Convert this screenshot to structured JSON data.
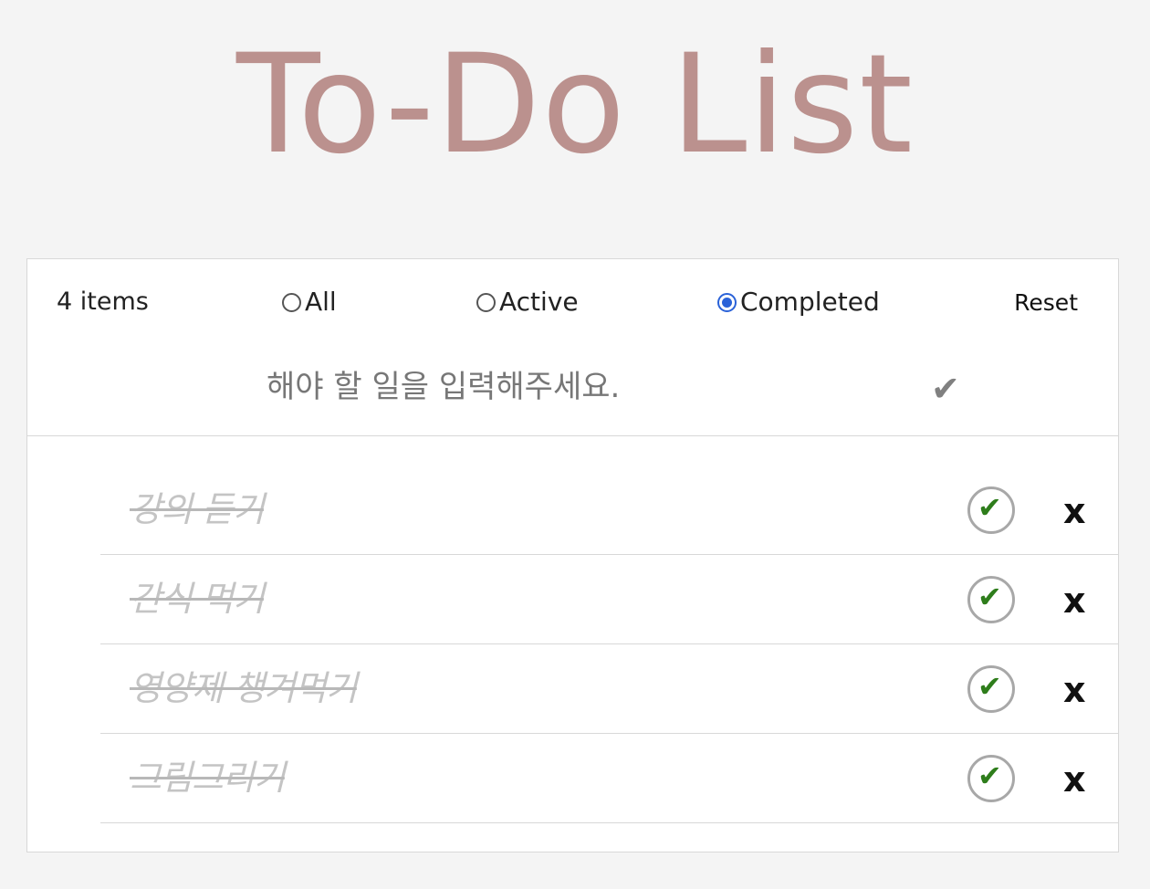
{
  "header": {
    "title": "To-Do List"
  },
  "controls": {
    "count_label": "4 items",
    "filters": [
      {
        "label": "All",
        "checked": false
      },
      {
        "label": "Active",
        "checked": false
      },
      {
        "label": "Completed",
        "checked": true
      }
    ],
    "reset_label": "Reset"
  },
  "input": {
    "placeholder": "해야 할 일을 입력해주세요.",
    "value": "",
    "submit_icon": "check-icon",
    "submit_glyph": "✔"
  },
  "todos": [
    {
      "text": "강의 듣기",
      "completed": true,
      "toggle_glyph": "✔",
      "delete_label": "x"
    },
    {
      "text": "간식 먹기",
      "completed": true,
      "toggle_glyph": "✔",
      "delete_label": "x"
    },
    {
      "text": "영양제 챙겨먹기",
      "completed": true,
      "toggle_glyph": "✔",
      "delete_label": "x"
    },
    {
      "text": "그림그리기",
      "completed": true,
      "toggle_glyph": "✔",
      "delete_label": "x"
    }
  ],
  "colors": {
    "title": "#bb918e",
    "radio_checked": "#2a62d8",
    "check_mark": "#2e7d1b",
    "completed_text": "#c4c4c4"
  }
}
